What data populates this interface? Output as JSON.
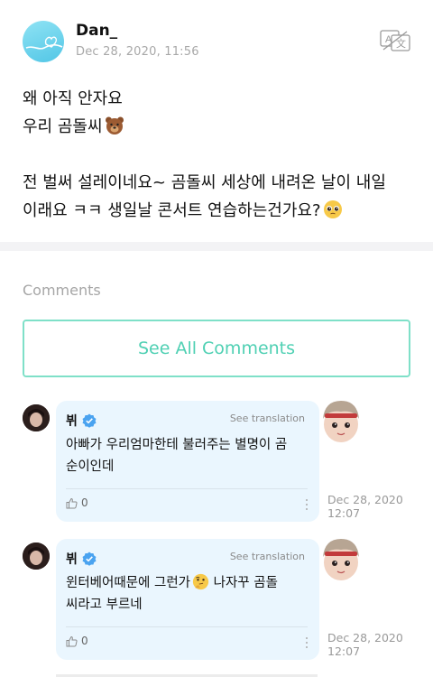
{
  "post": {
    "author": "Dan_",
    "date": "Dec 28, 2020, 11:56",
    "line1": "왜 아직 안자요",
    "line2": "우리 곰돌씨",
    "line3": "전 벌써 설레이네요~ 곰돌씨 세상에 내려온 날이 내일",
    "line4": "이래요 ㅋㅋ 생일날 콘서트 연습하는건가요?",
    "emoji_line2": "bear-face-emoji",
    "emoji_line4": "pleading-face-emoji"
  },
  "comments_section": {
    "title": "Comments",
    "see_all_label": "See All Comments"
  },
  "comments": [
    {
      "author": "뷔",
      "see_translation": "See translation",
      "text_line1": "아빠가 우리엄마한테 불러주는 별명이 곰",
      "text_line2": "순이인데",
      "likes": "0",
      "date_line1": "Dec 28, 2020",
      "date_line2": "12:07"
    },
    {
      "author": "뷔",
      "see_translation": "See translation",
      "text_line1a": "윈터베어때문에 그런가",
      "text_line1b": " 나자꾸 곰돌",
      "text_line2": "씨라고 부르네",
      "emoji": "thinking-face-emoji",
      "likes": "0",
      "date_line1": "Dec 28, 2020",
      "date_line2": "12:07"
    }
  ],
  "colors": {
    "accent": "#4fd0b3",
    "accent_border": "#7fe0c8",
    "bubble": "#eaf6fe",
    "verified": "#4aa3f0",
    "muted": "#a8a8a8"
  }
}
